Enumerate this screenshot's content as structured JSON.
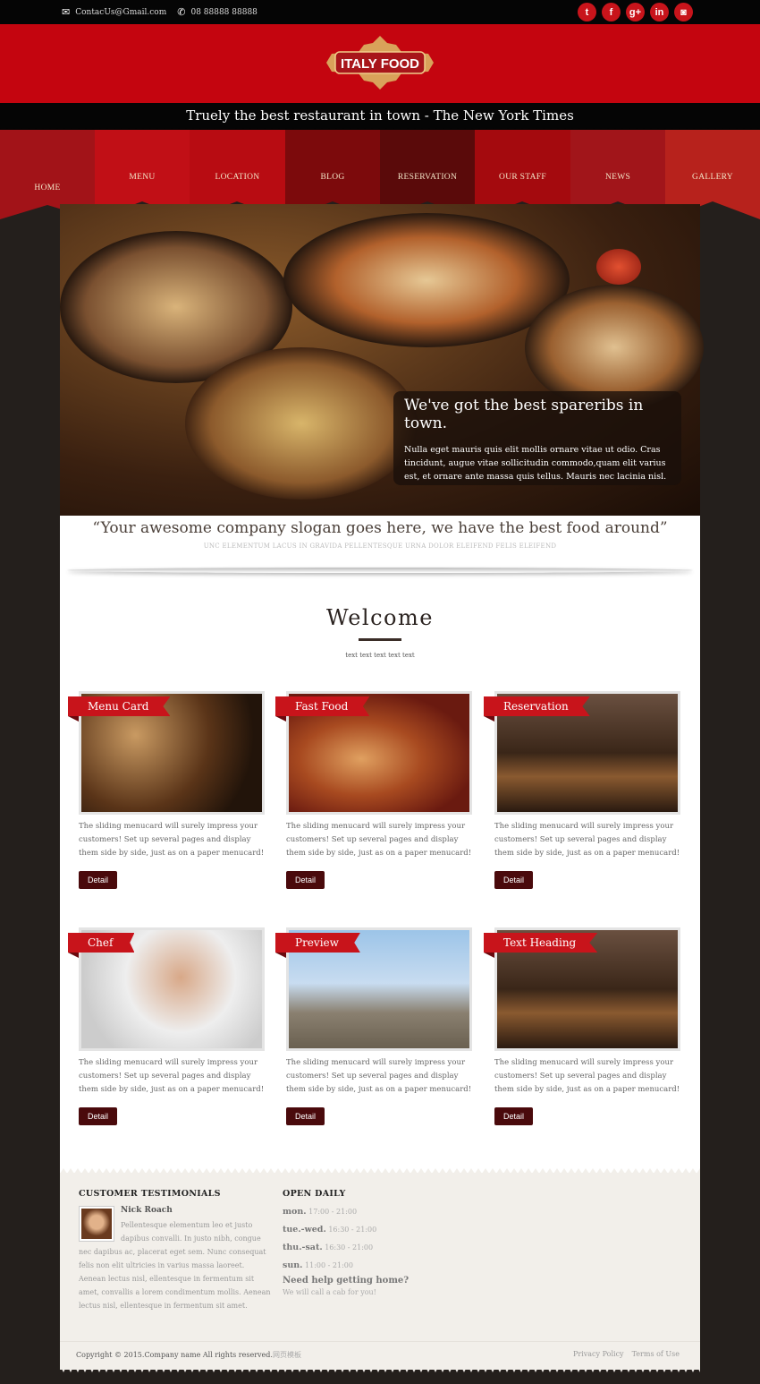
{
  "topbar": {
    "email": "ContacUs@Gmail.com",
    "phone": "08 88888 88888",
    "social": [
      {
        "name": "twitter",
        "glyph": "t"
      },
      {
        "name": "facebook",
        "glyph": "f"
      },
      {
        "name": "google-plus",
        "glyph": "g+"
      },
      {
        "name": "linkedin",
        "glyph": "in"
      },
      {
        "name": "instagram",
        "glyph": "◙"
      }
    ]
  },
  "header": {
    "logo_text": "ITALY FOOD",
    "tagline": "Truely the best restaurant in town - The New York Times"
  },
  "nav": {
    "items": [
      {
        "label": "HOME",
        "color": "#a21318"
      },
      {
        "label": "MENU",
        "color": "#c10f16"
      },
      {
        "label": "LOCATION",
        "color": "#b80c12"
      },
      {
        "label": "BLOG",
        "color": "#7c0a0c"
      },
      {
        "label": "RESERVATION",
        "color": "#5a0a0a"
      },
      {
        "label": "OUR STAFF",
        "color": "#a40a0e"
      },
      {
        "label": "NEWS",
        "color": "#a1151a"
      },
      {
        "label": "GALLERY",
        "color": "#b7221c"
      }
    ]
  },
  "hero": {
    "title": "We've got the best spareribs in town.",
    "text": "Nulla eget mauris quis elit mollis ornare vitae ut odio. Cras tincidunt, augue vitae sollicitudin commodo,quam elit varius est, et ornare ante massa quis tellus. Mauris nec lacinia nisl."
  },
  "slogan": {
    "quote": "“Your awesome company slogan goes here, we have the best food around”",
    "sub": "UNC ELEMENTUM LACUS IN GRAVIDA PELLENTESQUE URNA DOLOR ELEIFEND FELIS ELEIFEND"
  },
  "welcome": {
    "title": "Welcome",
    "sub": "text text text text text"
  },
  "cards": [
    {
      "title": "Menu Card",
      "text": "The sliding menucard will surely impress your customers! Set up several pages and display them side by side, just as on a paper menucard!",
      "button": "Detail",
      "image": "food-platter"
    },
    {
      "title": "Fast Food",
      "text": "The sliding menucard will surely impress your customers! Set up several pages and display them side by side, just as on a paper menucard!",
      "button": "Detail",
      "image": "burger-fries"
    },
    {
      "title": "Reservation",
      "text": "The sliding menucard will surely impress your customers! Set up several pages and display them side by side, just as on a paper menucard!",
      "button": "Detail",
      "image": "restaurant-table"
    },
    {
      "title": "Chef",
      "text": "The sliding menucard will surely impress your customers! Set up several pages and display them side by side, just as on a paper menucard!",
      "button": "Detail",
      "image": "chef"
    },
    {
      "title": "Preview",
      "text": "The sliding menucard will surely impress your customers! Set up several pages and display them side by side, just as on a paper menucard!",
      "button": "Detail",
      "image": "man-portrait"
    },
    {
      "title": "Text Heading",
      "text": "The sliding menucard will surely impress your customers! Set up several pages and display them side by side, just as on a paper menucard!",
      "button": "Detail",
      "image": "restaurant-table"
    }
  ],
  "footer": {
    "testimonials": {
      "heading": "CUSTOMER TESTIMONIALS",
      "name": "Nick Roach",
      "text": "Pellentesque elementum leo et justo dapibus convalli. In justo nibh, congue nec dapibus ac, placerat eget sem. Nunc consequat felis non elit ultricies in varius massa laoreet. Aenean lectus nisl, ellentesque in fermentum sit amet, convallis a lorem condimentum mollis. Aenean lectus nisl, ellentesque in fermentum sit amet."
    },
    "hours": {
      "heading": "OPEN DAILY",
      "rows": [
        {
          "day": "mon.",
          "time": "17:00 - 21:00"
        },
        {
          "day": "tue.-wed.",
          "time": "16:30 - 21:00"
        },
        {
          "day": "thu.-sat.",
          "time": "16:30 - 21:00"
        },
        {
          "day": "sun.",
          "time": "11:00 - 21:00"
        }
      ],
      "help_title": "Need help getting home?",
      "help_text": "We will call a cab for you!"
    },
    "copyright": "Copyright © 2015.Company name All rights reserved.",
    "copyright_cn": "网页模板",
    "links": [
      "Privacy Policy",
      "Terms of Use"
    ]
  }
}
